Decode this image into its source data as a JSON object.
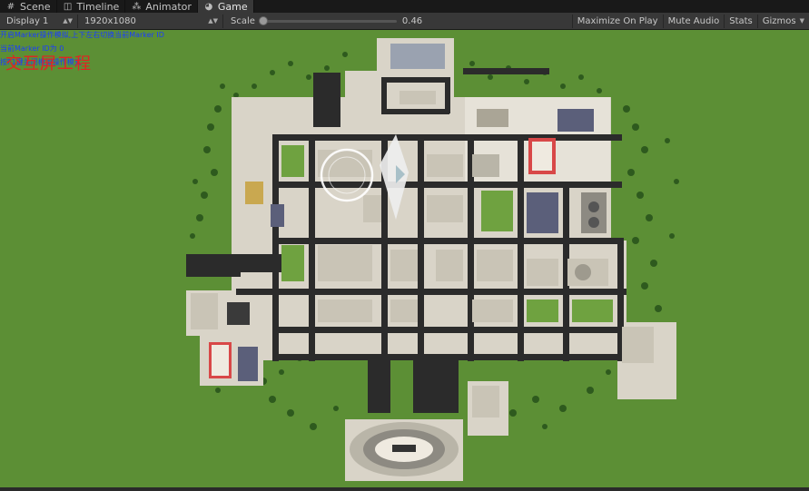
{
  "tabs": [
    {
      "label": "Scene",
      "icon": "scene-icon"
    },
    {
      "label": "Timeline",
      "icon": "timeline-icon"
    },
    {
      "label": "Animator",
      "icon": "animator-icon"
    },
    {
      "label": "Game",
      "icon": "game-icon"
    }
  ],
  "toolbar": {
    "display": "Display 1",
    "resolution": "1920x1080",
    "scale_label": "Scale",
    "scale_value": "0.46",
    "maximize": "Maximize On Play",
    "mute": "Mute Audio",
    "stats": "Stats",
    "gizmos": "Gizmos"
  },
  "overlay": {
    "line1": "开启Marker操作模拟,上下左右切换当前Marker ID",
    "line2": "当前Marker ID为 0",
    "line3": "按F1键关闭模拟操作模式",
    "title": "交互屏工程"
  },
  "colors": {
    "grass": "#5c8f35",
    "road": "#2b2b2b",
    "sidewalk": "#d9d4c8",
    "overlay_text": "#1a3cff",
    "title_text": "#e32222"
  }
}
